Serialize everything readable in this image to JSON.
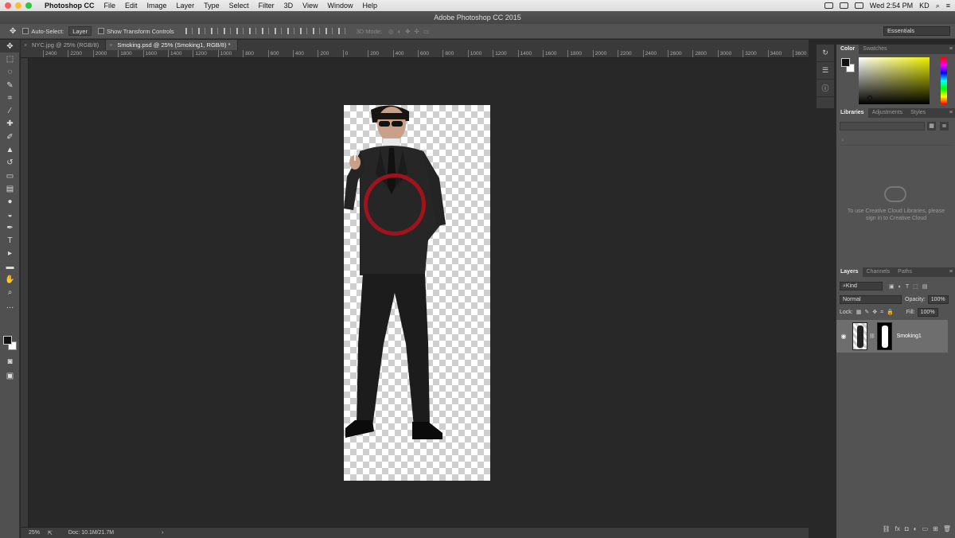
{
  "menubar": {
    "app_name": "Photoshop CC",
    "items": [
      "File",
      "Edit",
      "Image",
      "Layer",
      "Type",
      "Select",
      "Filter",
      "3D",
      "View",
      "Window",
      "Help"
    ],
    "clock": "Wed 2:54 PM",
    "user": "KD",
    "traffic_colors": [
      "#fc5f57",
      "#fdbc2e",
      "#28c840"
    ]
  },
  "window": {
    "title": "Adobe Photoshop CC 2015"
  },
  "options_bar": {
    "auto_select_label": "Auto-Select:",
    "auto_select_value": "Layer",
    "show_transform_label": "Show Transform Controls",
    "mode_3d_label": "3D Mode:",
    "workspace_value": "Essentials"
  },
  "tabs": [
    {
      "label": "NYC.jpg @ 25% (RGB/8)"
    },
    {
      "label": "Smoking.psd @ 25% (Smoking1, RGB/8) *"
    }
  ],
  "ruler_labels": [
    "2400",
    "2200",
    "2000",
    "1800",
    "1600",
    "1400",
    "1200",
    "1000",
    "800",
    "600",
    "400",
    "200",
    "0",
    "200",
    "400",
    "600",
    "800",
    "1000",
    "1200",
    "1400",
    "1600",
    "1800",
    "2000",
    "2200",
    "2400",
    "2600",
    "2800",
    "3000",
    "3200",
    "3400",
    "3600"
  ],
  "status": {
    "zoom": "25%",
    "doc": "Doc: 10.1M/21.7M"
  },
  "tools": [
    {
      "name": "move-tool",
      "glyph": "✥"
    },
    {
      "name": "marquee-tool",
      "glyph": "⬚"
    },
    {
      "name": "lasso-tool",
      "glyph": "◌"
    },
    {
      "name": "quick-select-tool",
      "glyph": "✎"
    },
    {
      "name": "crop-tool",
      "glyph": "⌗"
    },
    {
      "name": "eyedropper-tool",
      "glyph": "⁄"
    },
    {
      "name": "healing-tool",
      "glyph": "✚"
    },
    {
      "name": "brush-tool",
      "glyph": "✐"
    },
    {
      "name": "stamp-tool",
      "glyph": "▲"
    },
    {
      "name": "history-brush-tool",
      "glyph": "↺"
    },
    {
      "name": "eraser-tool",
      "glyph": "▭"
    },
    {
      "name": "gradient-tool",
      "glyph": "▤"
    },
    {
      "name": "blur-tool",
      "glyph": "●"
    },
    {
      "name": "dodge-tool",
      "glyph": "◒"
    },
    {
      "name": "pen-tool",
      "glyph": "✒"
    },
    {
      "name": "type-tool",
      "glyph": "T"
    },
    {
      "name": "path-select-tool",
      "glyph": "▸"
    },
    {
      "name": "shape-tool",
      "glyph": "▬"
    },
    {
      "name": "hand-tool",
      "glyph": "✋"
    },
    {
      "name": "zoom-tool",
      "glyph": "⌕"
    },
    {
      "name": "more-tools",
      "glyph": "…"
    }
  ],
  "panels": {
    "color_tabs": [
      "Color",
      "Swatches"
    ],
    "library_tabs": [
      "Libraries",
      "Adjustments",
      "Styles"
    ],
    "library_message": "To use Creative Cloud Libraries, please sign in to Creative Cloud",
    "layers_tabs": [
      "Layers",
      "Channels",
      "Paths"
    ],
    "kind_label": "Kind",
    "blend_mode": "Normal",
    "opacity_label": "Opacity:",
    "opacity_value": "100%",
    "lock_label": "Lock:",
    "fill_label": "Fill:",
    "fill_value": "100%",
    "layer_name": "Smoking1"
  },
  "colors": {
    "accent_brush": "#b01820",
    "foreground": "#111111",
    "background": "#ffffff"
  }
}
